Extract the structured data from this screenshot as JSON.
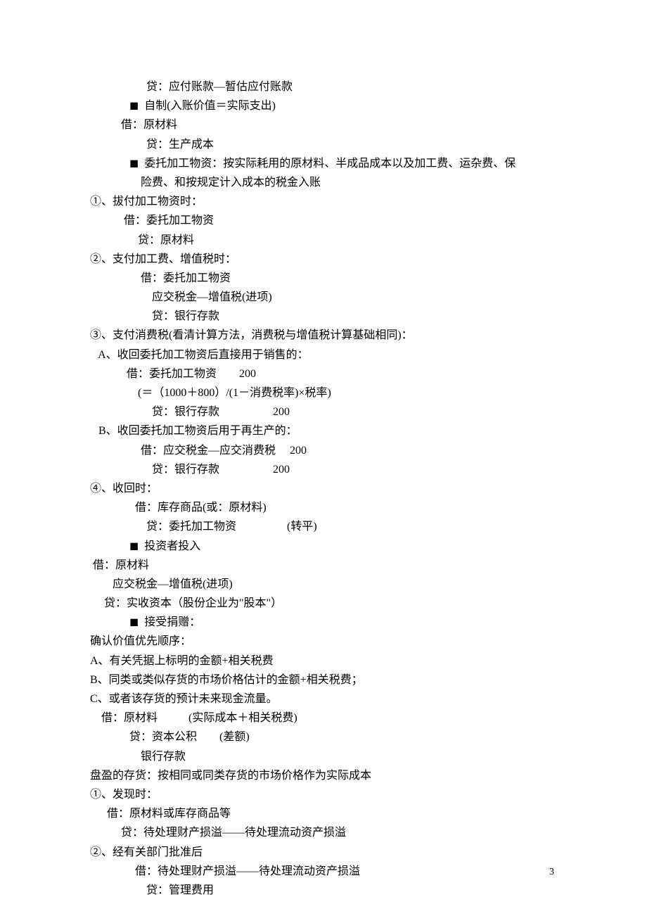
{
  "lines": {
    "l1": "                    贷：应付账款—暂估应付账款",
    "l2": "              ◼  自制(入账价值＝实际支出)",
    "l3": "           借：原材料",
    "l4": "                    贷：生产成本",
    "l5": "              ◼  委托加工物资：按实际耗用的原材料、半成品成本以及加工费、运杂费、保",
    "l6": "                  险费、和按规定计入成本的税金入账",
    "l7": "①、拔付加工物资时：",
    "l8": "            借：委托加工物资",
    "l9": "                 贷：原材料",
    "l10": "②、支付加工费、增值税时：",
    "l11": "                  借：委托加工物资",
    "l12": "                      应交税金—增值税(进项)",
    "l13": "                      贷：银行存款",
    "l14": "③、支付消费税(看清计算方法，消费税与增值税计算基础相同)：",
    "l15": "   A、收回委托加工物资后直接用于销售的：",
    "l16": "             借：委托加工物资        200",
    "l17": "                 (＝（1000＋800）/(1－消费税率)×税率)",
    "l18": "                      贷：银行存款                   200",
    "l19": "   B、收回委托加工物资后用于再生产的：",
    "l20": "                  借：应交税金—应交消费税     200",
    "l21": "                      贷：银行存款                   200",
    "l22": "④、收回时：",
    "l23": "                借：库存商品(或：原材料)",
    "l24": "                    贷：委托加工物资                  (转平)",
    "l25": "              ◼  投资者投入",
    "l26": " 借：原材料",
    "l27": "        应交税金—增值税(进项)",
    "l28": "     贷：实收资本（股份企业为\"股本\"）",
    "l29": "              ◼  接受捐赠：",
    "l30": "确认价值优先顺序：",
    "l31": "A、有关凭据上标明的金额+相关税费",
    "l32": "B、同类或类似存货的市场价格估计的金额+相关税费；",
    "l33": "C、或者该存货的预计未来现金流量。",
    "l34": "",
    "l35": "    借：原材料           (实际成本＋相关税费)",
    "l36": "              贷：资本公积        (差额)",
    "l37": "                  银行存款",
    "l38": "盘盈的存货：按相同或同类存货的市场价格作为实际成本",
    "l39": "①、发现时：",
    "l40": "      借：原材料或库存商品等",
    "l41": "           贷：待处理财产损溢——待处理流动资产损溢",
    "l42": "②、经有关部门批准后",
    "l43": "                借：待处理财产损溢——待处理流动资产损溢",
    "l44": "                    贷：管理费用"
  },
  "pageNumber": "3"
}
